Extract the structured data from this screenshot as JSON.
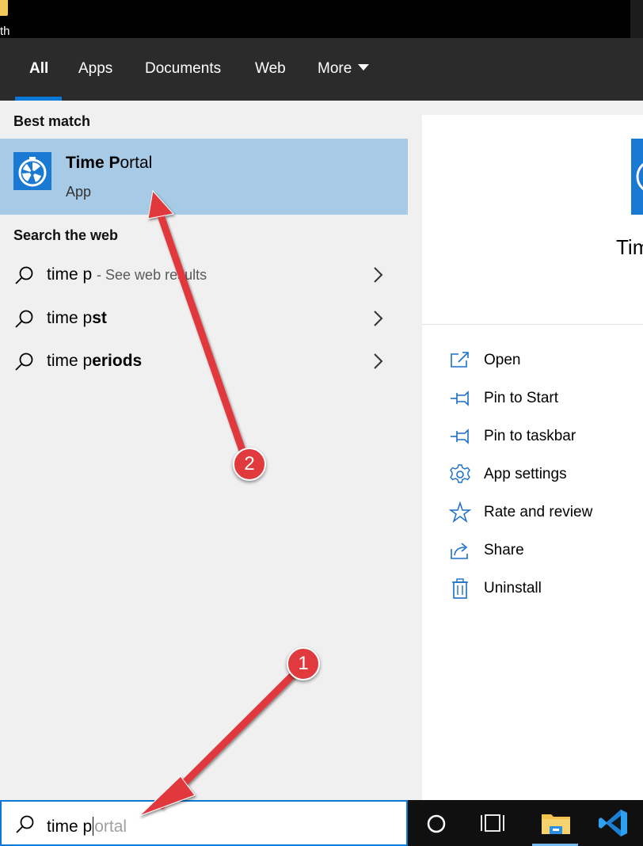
{
  "desktop": {
    "partial_text": "th"
  },
  "tabs": [
    {
      "label": "All",
      "active": true
    },
    {
      "label": "Apps"
    },
    {
      "label": "Documents"
    },
    {
      "label": "Web"
    },
    {
      "label": "More"
    }
  ],
  "best_match": {
    "heading": "Best match",
    "name_bold": "Time P",
    "name_rest": "ortal",
    "type": "App",
    "icon": "time-portal-app-icon"
  },
  "search_web": {
    "heading": "Search the web",
    "items": [
      {
        "prefix": "time p",
        "suffix": "",
        "hint": "- See web results"
      },
      {
        "prefix": "time p",
        "suffix": "st",
        "hint": ""
      },
      {
        "prefix": "time p",
        "suffix": "eriods",
        "hint": ""
      }
    ]
  },
  "preview": {
    "title_partial": "Tim"
  },
  "actions": [
    {
      "label": "Open",
      "icon": "open-icon"
    },
    {
      "label": "Pin to Start",
      "icon": "pin-icon"
    },
    {
      "label": "Pin to taskbar",
      "icon": "pin-icon"
    },
    {
      "label": "App settings",
      "icon": "gear-icon"
    },
    {
      "label": "Rate and review",
      "icon": "star-icon"
    },
    {
      "label": "Share",
      "icon": "share-icon"
    },
    {
      "label": "Uninstall",
      "icon": "trash-icon"
    }
  ],
  "search": {
    "typed": "time p",
    "autocomplete": "ortal"
  },
  "annotations": [
    {
      "label": "1"
    },
    {
      "label": "2"
    }
  ],
  "colors": {
    "accent": "#0a78d7",
    "selected_row": "#a7cbe6",
    "annotation": "#e0393e",
    "tab_bar": "#2b2b2b"
  }
}
